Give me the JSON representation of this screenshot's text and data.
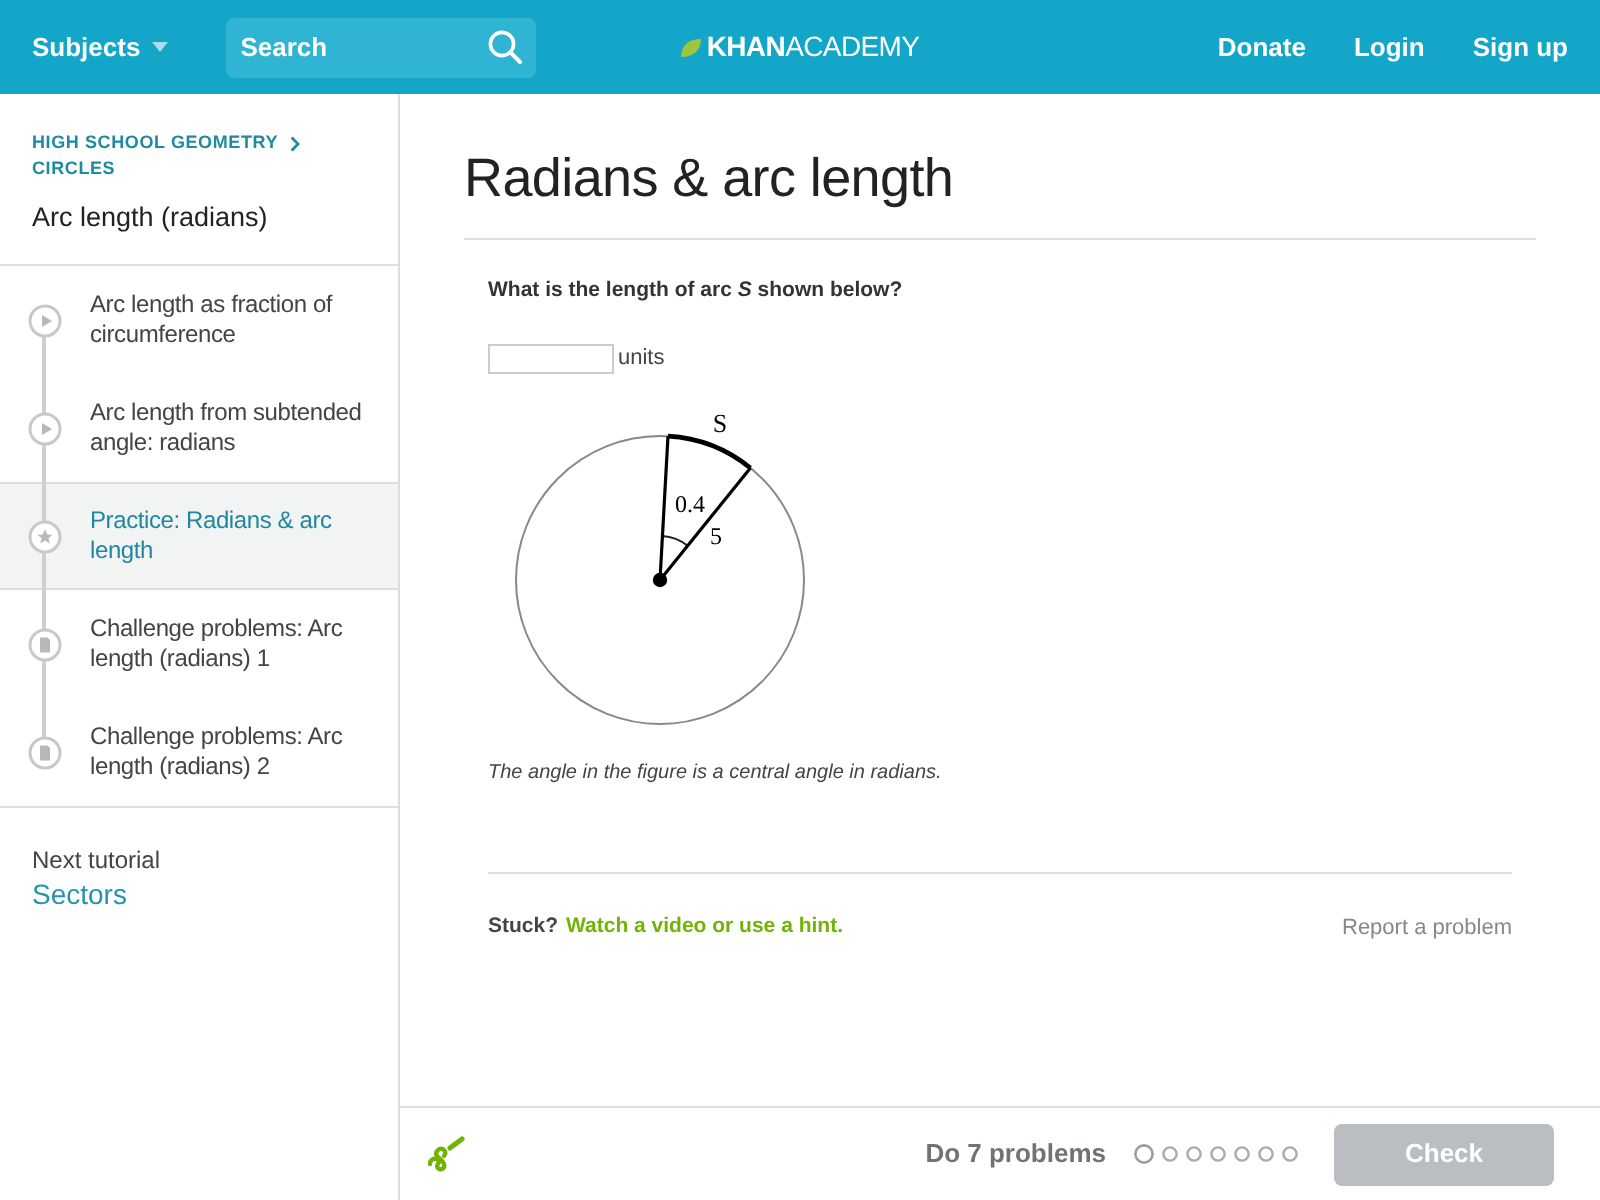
{
  "header": {
    "subjects": "Subjects",
    "search": {
      "placeholder": "Search"
    },
    "logo": "**KHAN**ACADEMY",
    "links": [
      "Donate",
      "Login",
      "Sign up"
    ]
  },
  "sidebar": {
    "breadcrumb": [
      "HIGH SCHOOL GEOMETRY",
      "CIRCLES"
    ],
    "title": "Arc length (radians)",
    "items": [
      {
        "kind": "video",
        "label": "Arc length as fraction of circumference",
        "selected": false
      },
      {
        "kind": "video",
        "label": "Arc length from subtended angle: radians",
        "selected": false
      },
      {
        "kind": "practice",
        "label": "Practice: Radians & arc length",
        "selected": true
      },
      {
        "kind": "challenge",
        "label": "Challenge problems: Arc length (radians) 1",
        "selected": false
      },
      {
        "kind": "challenge",
        "label": "Challenge problems: Arc length (radians) 2",
        "selected": false
      }
    ],
    "next_label": "Next tutorial",
    "next_link": "Sectors"
  },
  "main": {
    "title": "Radians & arc length",
    "question": "What is the length of arc *S* shown below?",
    "answer_unit": "units",
    "figure": {
      "arc_label": "S",
      "angle_label": "0.4",
      "radius_label": "5"
    },
    "caption": "The angle in the figure is a central angle in radians.",
    "stuck": "Stuck?",
    "hint_link": "Watch a video or use a hint.",
    "report": "Report a problem"
  },
  "footer": {
    "goal": "Do 7 problems",
    "dots": [
      {
        "current": true
      },
      {
        "current": false
      },
      {
        "current": false
      },
      {
        "current": false
      },
      {
        "current": false
      },
      {
        "current": false
      },
      {
        "current": false
      }
    ],
    "check": {
      "label": "Check",
      "disabled": true
    }
  }
}
